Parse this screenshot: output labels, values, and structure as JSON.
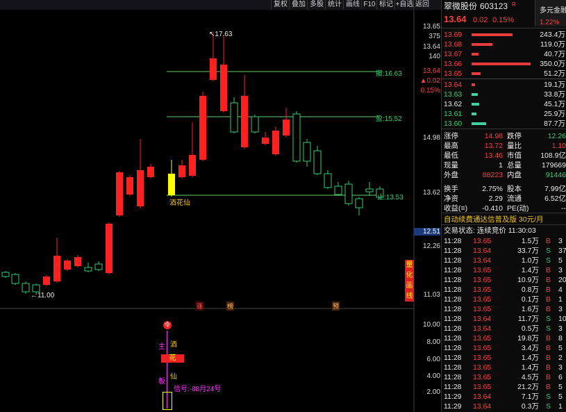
{
  "toolbar": {
    "buttons": [
      "复权",
      "叠加",
      "多股",
      "统计",
      "画线",
      "F10",
      "标记",
      "+自选",
      "返回"
    ]
  },
  "chart": {
    "y_axis_labels": [
      "13.65",
      "375",
      "13.64",
      "140",
      "13.64",
      "▲0.02",
      "0.15%",
      "14.98",
      "13.62",
      "12.51",
      "12.26",
      "11.03",
      "10.00",
      "8.00",
      "6.00",
      "4.00",
      "2.00"
    ],
    "high_label": "17.63",
    "low_label": "11.00",
    "line_labels": [
      "撤:16.63",
      "盈:15.52",
      "止:13.53"
    ],
    "marker_label": "酒花仙",
    "bottom_markers": [
      "涨",
      "榜",
      "预"
    ],
    "side_button": [
      "量",
      "化",
      "画",
      "线"
    ],
    "sub_chart": {
      "label_left_1": "主",
      "label_left_2": "板",
      "vertical_chars": [
        "酒",
        "花",
        "仙"
      ],
      "signal_text": "信号:-88月24号",
      "top_badge": "令",
      "bottom_badge": "↑"
    }
  },
  "stock": {
    "name": "翠微股份",
    "code": "603123",
    "badge": "R",
    "price": "13.64",
    "change": "0.02",
    "pct": "0.15%",
    "tab": "多元金融",
    "tab_pct": "1.22%"
  },
  "order_book": {
    "asks": [
      {
        "price": "13.69",
        "vol": "243.4万",
        "bar": 0.7
      },
      {
        "price": "13.68",
        "vol": "119.0万",
        "bar": 0.35
      },
      {
        "price": "13.67",
        "vol": "40.7万",
        "bar": 0.12
      },
      {
        "price": "13.66",
        "vol": "350.0万",
        "bar": 1.0
      },
      {
        "price": "13.65",
        "vol": "51.2万",
        "bar": 0.15
      }
    ],
    "bids": [
      {
        "price": "13.64",
        "vol": "19.1万",
        "bar": 0.06
      },
      {
        "price": "13.63",
        "vol": "33.8万",
        "bar": 0.1
      },
      {
        "price": "13.62",
        "vol": "45.1万",
        "bar": 0.13
      },
      {
        "price": "13.61",
        "vol": "25.9万",
        "bar": 0.08
      },
      {
        "price": "13.60",
        "vol": "87.7万",
        "bar": 0.25
      }
    ]
  },
  "stats": [
    {
      "k1": "涨停",
      "v1": "14.98",
      "k2": "跌停",
      "v2": "12.26"
    },
    {
      "k1": "最高",
      "v1": "13.72",
      "k2": "量比",
      "v2": "1.10"
    },
    {
      "k1": "最低",
      "v1": "13.46",
      "k2": "市值",
      "v2": "108.9亿"
    },
    {
      "k1": "现量",
      "v1": "1",
      "k2": "总量",
      "v2": "179669"
    },
    {
      "k1": "外盘",
      "v1": "88223",
      "k2": "内盘",
      "v2": "91446"
    },
    {
      "k1": "换手",
      "v1": "2.75%",
      "k2": "股本",
      "v2": "7.99亿"
    },
    {
      "k1": "净资",
      "v1": "2.29",
      "k2": "流通",
      "v2": "6.52亿"
    },
    {
      "k1": "收益(≡)",
      "v1": "-0.410",
      "k2": "PE(动)",
      "v2": "--"
    }
  ],
  "promo": "自动续费通达信普及版   30元/月",
  "trade_status": "交易状态: 连续竞价 11:30:03",
  "ticks": [
    {
      "t": "11:28",
      "p": "13.65",
      "v": "1.5万",
      "s": "B",
      "n": "3"
    },
    {
      "t": "11:28",
      "p": "13.64",
      "v": "33.7万",
      "s": "S",
      "n": "37"
    },
    {
      "t": "11:28",
      "p": "13.64",
      "v": "1.0万",
      "s": "S",
      "n": "5"
    },
    {
      "t": "11:28",
      "p": "13.65",
      "v": "1.4万",
      "s": "B",
      "n": "3"
    },
    {
      "t": "11:28",
      "p": "13.65",
      "v": "10.9万",
      "s": "B",
      "n": "20"
    },
    {
      "t": "11:28",
      "p": "13.65",
      "v": "0.8万",
      "s": "B",
      "n": "4"
    },
    {
      "t": "11:28",
      "p": "13.65",
      "v": "0.1万",
      "s": "B",
      "n": "1"
    },
    {
      "t": "11:28",
      "p": "13.65",
      "v": "1.6万",
      "s": "B",
      "n": "3"
    },
    {
      "t": "11:28",
      "p": "13.64",
      "v": "11.7万",
      "s": "S",
      "n": "10"
    },
    {
      "t": "11:28",
      "p": "13.64",
      "v": "0.5万",
      "s": "S",
      "n": "3"
    },
    {
      "t": "11:28",
      "p": "13.65",
      "v": "19.8万",
      "s": "B",
      "n": "8"
    },
    {
      "t": "11:28",
      "p": "13.65",
      "v": "3.4万",
      "s": "B",
      "n": "5"
    },
    {
      "t": "11:28",
      "p": "13.65",
      "v": "1.4万",
      "s": "B",
      "n": "2"
    },
    {
      "t": "11:28",
      "p": "13.65",
      "v": "1.4万",
      "s": "B",
      "n": "3"
    },
    {
      "t": "11:28",
      "p": "13.65",
      "v": "4.5万",
      "s": "B",
      "n": "6"
    },
    {
      "t": "11:28",
      "p": "13.65",
      "v": "21.2万",
      "s": "B",
      "n": "5"
    },
    {
      "t": "11:29",
      "p": "13.64",
      "v": "7.1万",
      "s": "S",
      "n": "5"
    },
    {
      "t": "11:29",
      "p": "13.64",
      "v": "0.3万",
      "s": "S",
      "n": "1"
    }
  ],
  "colors": {
    "up": "#ff2020",
    "down": "#2ecc71",
    "line_green": "#5fd35f",
    "signal": "#ff30ff"
  }
}
